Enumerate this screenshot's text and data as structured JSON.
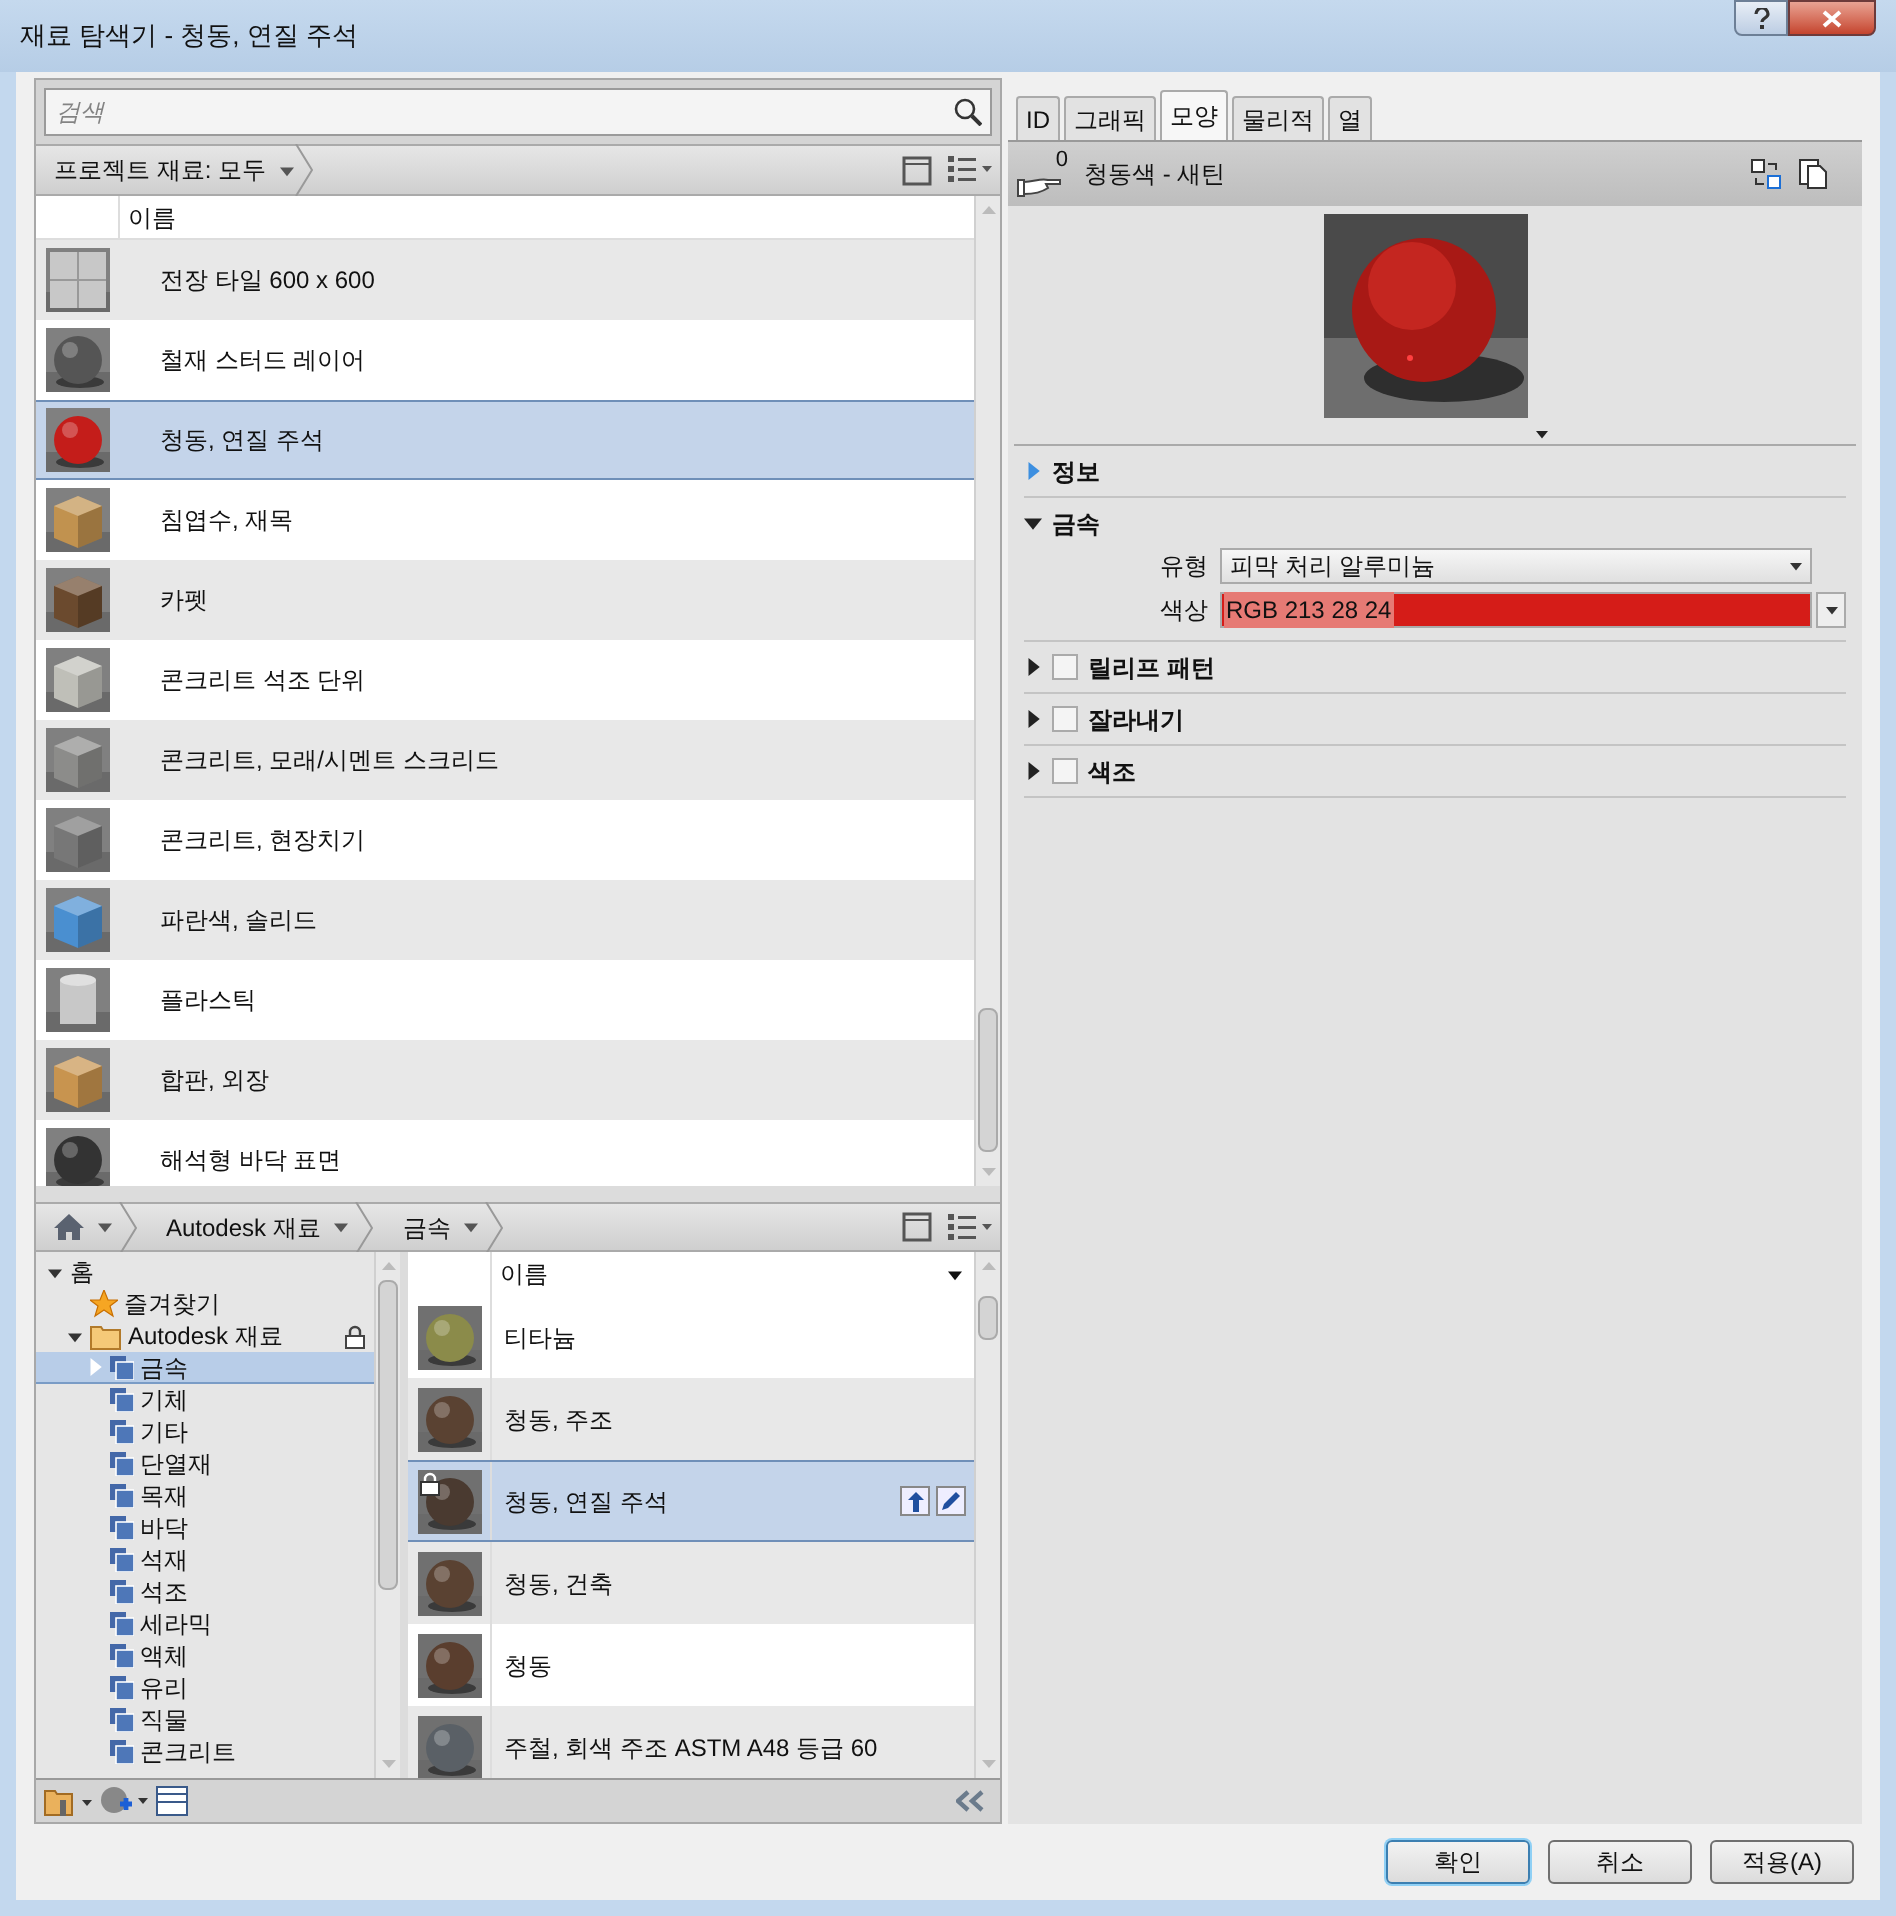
{
  "window": {
    "title": "재료 탐색기 - 청동, 연질 주석"
  },
  "search": {
    "placeholder": "검색"
  },
  "project_bar": {
    "label": "프로젝트 재료: 모두"
  },
  "project_table": {
    "column_header": "이름",
    "rows": [
      {
        "name": "전장 타일 600 x 600",
        "selected": false
      },
      {
        "name": "철재 스터드 레이어",
        "selected": false
      },
      {
        "name": "청동, 연질 주석",
        "selected": true
      },
      {
        "name": "침엽수, 재목",
        "selected": false
      },
      {
        "name": "카펫",
        "selected": false
      },
      {
        "name": "콘크리트 석조 단위",
        "selected": false
      },
      {
        "name": "콘크리트, 모래/시멘트 스크리드",
        "selected": false
      },
      {
        "name": "콘크리트, 현장치기",
        "selected": false
      },
      {
        "name": "파란색, 솔리드",
        "selected": false
      },
      {
        "name": "플라스틱",
        "selected": false
      },
      {
        "name": "합판, 외장",
        "selected": false
      },
      {
        "name": "해석형 바닥 표면",
        "selected": false
      }
    ]
  },
  "library_bar": {
    "crumbs": [
      "Autodesk 재료",
      "금속"
    ]
  },
  "tree": [
    {
      "label": "홈",
      "expanded": true,
      "selected": false,
      "children": [
        {
          "label": "즐겨찾기",
          "kind": "favorites",
          "selected": false
        },
        {
          "label": "Autodesk 재료",
          "kind": "library",
          "expanded": true,
          "locked": true,
          "selected": false,
          "children": [
            {
              "label": "금속",
              "kind": "category",
              "expanded": false,
              "selected": true
            },
            {
              "label": "기체",
              "kind": "category",
              "selected": false
            },
            {
              "label": "기타",
              "kind": "category",
              "selected": false
            },
            {
              "label": "단열재",
              "kind": "category",
              "selected": false
            },
            {
              "label": "목재",
              "kind": "category",
              "selected": false
            },
            {
              "label": "바닥",
              "kind": "category",
              "selected": false
            },
            {
              "label": "석재",
              "kind": "category",
              "selected": false
            },
            {
              "label": "석조",
              "kind": "category",
              "selected": false
            },
            {
              "label": "세라믹",
              "kind": "category",
              "selected": false
            },
            {
              "label": "액체",
              "kind": "category",
              "selected": false
            },
            {
              "label": "유리",
              "kind": "category",
              "selected": false
            },
            {
              "label": "직물",
              "kind": "category",
              "selected": false
            },
            {
              "label": "콘크리트",
              "kind": "category",
              "selected": false
            }
          ]
        }
      ]
    }
  ],
  "library_table": {
    "column_header": "이름",
    "rows": [
      {
        "name": "티타늄",
        "selected": false,
        "locked": false
      },
      {
        "name": "청동, 주조",
        "selected": false,
        "locked": false
      },
      {
        "name": "청동, 연질 주석",
        "selected": true,
        "locked": true
      },
      {
        "name": "청동, 건축",
        "selected": false,
        "locked": false
      },
      {
        "name": "청동",
        "selected": false,
        "locked": false
      },
      {
        "name": "주철, 회색 주조 ASTM A48 등급 60",
        "selected": false,
        "locked": false
      }
    ]
  },
  "tabs": [
    {
      "label": "ID",
      "selected": false
    },
    {
      "label": "그래픽",
      "selected": false
    },
    {
      "label": "모양",
      "selected": true
    },
    {
      "label": "물리적",
      "selected": false
    },
    {
      "label": "열",
      "selected": false
    }
  ],
  "asset": {
    "count": "0",
    "name": "청동색 - 새틴"
  },
  "sections": [
    {
      "title": "정보",
      "kind": "plain",
      "expanded": false
    },
    {
      "title": "금속",
      "kind": "plain",
      "expanded": true,
      "fields": [
        {
          "label": "유형",
          "kind": "dropdown",
          "value": "피막 처리 알루미늄"
        },
        {
          "label": "색상",
          "kind": "color",
          "value": "RGB 213 28 24",
          "color": "#d51c18"
        }
      ]
    },
    {
      "title": "릴리프 패턴",
      "kind": "toggle",
      "expanded": false,
      "checked": false
    },
    {
      "title": "잘라내기",
      "kind": "toggle",
      "expanded": false,
      "checked": false
    },
    {
      "title": "색조",
      "kind": "toggle",
      "expanded": false,
      "checked": false
    }
  ],
  "buttons": [
    {
      "label": "확인",
      "default": true
    },
    {
      "label": "취소",
      "default": false
    },
    {
      "label": "적용(A)",
      "default": false
    }
  ]
}
